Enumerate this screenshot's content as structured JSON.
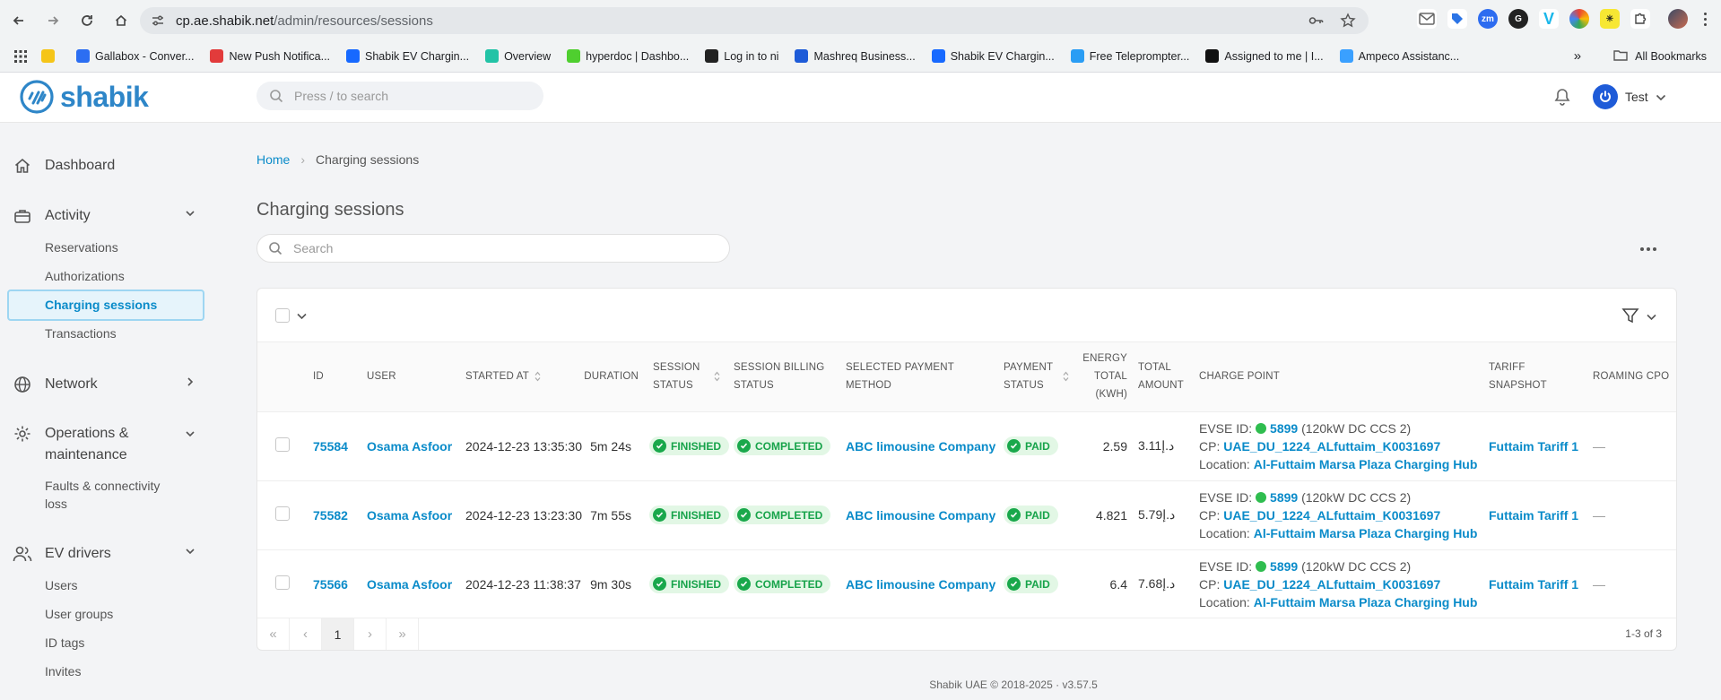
{
  "browser": {
    "url_host": "cp.ae.shabik.net",
    "url_path": "/admin/resources/sessions",
    "bookmarks": [
      {
        "label": "",
        "color": "#f5c518"
      },
      {
        "label": "Gallabox - Conver...",
        "color": "#2c6ef2"
      },
      {
        "label": "New Push Notifica...",
        "color": "#e23b3b"
      },
      {
        "label": "Shabik EV Chargin...",
        "color": "#1769ff"
      },
      {
        "label": "Overview",
        "color": "#22c3a6"
      },
      {
        "label": "hyperdoc | Dashbo...",
        "color": "#4fcf2f"
      },
      {
        "label": "Log in to ni",
        "color": "#222222"
      },
      {
        "label": "Mashreq Business...",
        "color": "#1e5bd8"
      },
      {
        "label": "Shabik EV Chargin...",
        "color": "#1769ff"
      },
      {
        "label": "Free Teleprompter...",
        "color": "#2a9df4"
      },
      {
        "label": "Assigned to me | I...",
        "color": "#111111"
      },
      {
        "label": "Ampeco Assistanc...",
        "color": "#3aa0ff"
      }
    ],
    "all_bookmarks": "All Bookmarks"
  },
  "header": {
    "logo": "shabik",
    "search_placeholder": "Press / to search",
    "user": "Test"
  },
  "sidebar": {
    "dashboard": "Dashboard",
    "activity": "Activity",
    "activity_items": [
      "Reservations",
      "Authorizations",
      "Charging sessions",
      "Transactions"
    ],
    "network": "Network",
    "operations": "Operations & maintenance",
    "operations_items": [
      "Faults & connectivity loss"
    ],
    "ev_drivers": "EV drivers",
    "ev_items": [
      "Users",
      "User groups",
      "ID tags",
      "Invites"
    ]
  },
  "main": {
    "breadcrumb_home": "Home",
    "breadcrumb_current": "Charging sessions",
    "title": "Charging sessions",
    "search_placeholder": "Search"
  },
  "table": {
    "columns": {
      "id": "ID",
      "user": "USER",
      "started_at": "STARTED AT",
      "duration": "DURATION",
      "session_status": "SESSION STATUS",
      "billing_status": "SESSION BILLING STATUS",
      "payment_method": "SELECTED PAYMENT METHOD",
      "payment_status": "PAYMENT STATUS",
      "energy": "ENERGY TOTAL (KWH)",
      "amount": "TOTAL AMOUNT",
      "charge_point": "CHARGE POINT",
      "tariff": "TARIFF SNAPSHOT",
      "roaming": "ROAMING CPO"
    },
    "rows": [
      {
        "id": "75584",
        "user": "Osama Asfoor",
        "started_at": "2024-12-23 13:35:30",
        "duration": "5m 24s",
        "session_status": "FINISHED",
        "billing_status": "COMPLETED",
        "payment_method": "ABC limousine Company",
        "payment_status": "PAID",
        "energy": "2.59",
        "amount": "3.11د.إ",
        "evse_label": "EVSE ID:",
        "evse_id": "5899",
        "evse_desc": "(120kW DC CCS 2)",
        "cp_label": "CP:",
        "cp": "UAE_DU_1224_ALfuttaim_K0031697",
        "location_label": "Location:",
        "location": "Al-Futtaim Marsa Plaza Charging Hub",
        "tariff": "Futtaim Tariff 1",
        "roaming": "—"
      },
      {
        "id": "75582",
        "user": "Osama Asfoor",
        "started_at": "2024-12-23 13:23:30",
        "duration": "7m 55s",
        "session_status": "FINISHED",
        "billing_status": "COMPLETED",
        "payment_method": "ABC limousine Company",
        "payment_status": "PAID",
        "energy": "4.821",
        "amount": "5.79د.إ",
        "evse_label": "EVSE ID:",
        "evse_id": "5899",
        "evse_desc": "(120kW DC CCS 2)",
        "cp_label": "CP:",
        "cp": "UAE_DU_1224_ALfuttaim_K0031697",
        "location_label": "Location:",
        "location": "Al-Futtaim Marsa Plaza Charging Hub",
        "tariff": "Futtaim Tariff 1",
        "roaming": "—"
      },
      {
        "id": "75566",
        "user": "Osama Asfoor",
        "started_at": "2024-12-23 11:38:37",
        "duration": "9m 30s",
        "session_status": "FINISHED",
        "billing_status": "COMPLETED",
        "payment_method": "ABC limousine Company",
        "payment_status": "PAID",
        "energy": "6.4",
        "amount": "7.68د.إ",
        "evse_label": "EVSE ID:",
        "evse_id": "5899",
        "evse_desc": "(120kW DC CCS 2)",
        "cp_label": "CP:",
        "cp": "UAE_DU_1224_ALfuttaim_K0031697",
        "location_label": "Location:",
        "location": "Al-Futtaim Marsa Plaza Charging Hub",
        "tariff": "Futtaim Tariff 1",
        "roaming": "—"
      }
    ]
  },
  "pagination": {
    "first": "«",
    "prev": "‹",
    "page": "1",
    "next": "›",
    "last": "»",
    "info": "1-3 of 3"
  },
  "footer": "Shabik UAE © 2018-2025 · v3.57.5",
  "colors": {
    "brand": "#2e86c8",
    "link": "#0a8bc9",
    "success": "#19a84b",
    "success_bg": "#e2f7e5"
  }
}
